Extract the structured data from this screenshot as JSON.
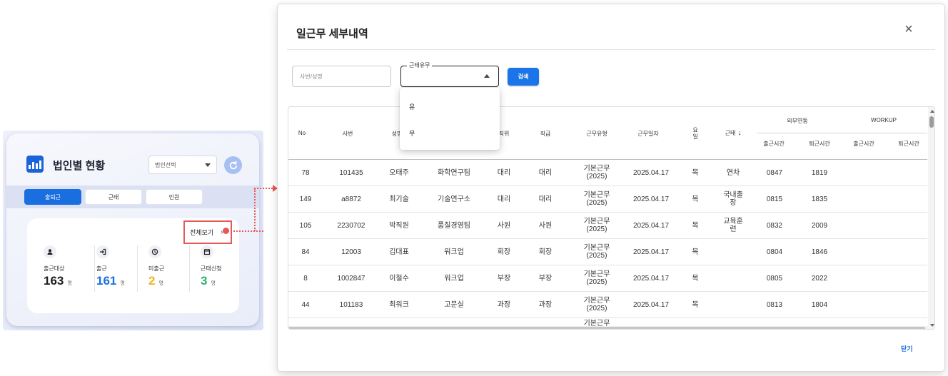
{
  "widget": {
    "title": "법인별 현황",
    "corp_select": "법인선택",
    "tabs": [
      {
        "label": "출퇴근",
        "active": true
      },
      {
        "label": "근태",
        "active": false
      },
      {
        "label": "인원",
        "active": false
      }
    ],
    "view_all": "전체보기",
    "unit": "명",
    "stats": [
      {
        "label": "출근대상",
        "value": "163",
        "color": "#1c1c1c",
        "icon": "person-icon"
      },
      {
        "label": "출근",
        "value": "161",
        "color": "#1a6fe0",
        "icon": "login-icon"
      },
      {
        "label": "미출근",
        "value": "2",
        "color": "#f2b51b",
        "icon": "clock-icon"
      },
      {
        "label": "근태신청",
        "value": "3",
        "color": "#2ab36a",
        "icon": "calendar-icon"
      }
    ]
  },
  "modal": {
    "title": "일근무 세부내역",
    "search_placeholder": "사번/성명",
    "attendance_label": "근태유무",
    "search_button": "검색",
    "dropdown_options": [
      "유",
      "무"
    ],
    "close_button": "닫기",
    "headers": {
      "no": "No",
      "emp_id": "사번",
      "name": "성명",
      "position": "직위",
      "rank": "직급",
      "work_type": "근무유형",
      "work_date": "근무일자",
      "weekday": "요일",
      "attendance": "근태",
      "external": "외부연동",
      "workup": "WORKUP",
      "clock_in": "출근시간",
      "clock_out": "퇴근시간"
    },
    "rows": [
      {
        "no": "78",
        "emp_id": "101435",
        "name": "오태주",
        "dept": "화학연구팀",
        "position": "대리",
        "rank": "대리",
        "work_type": "기본근무 (2025)",
        "work_date": "2025.04.17",
        "weekday": "목",
        "attendance": "연차",
        "ext_in": "0847",
        "ext_out": "1819"
      },
      {
        "no": "149",
        "emp_id": "a8872",
        "name": "최기술",
        "dept": "기술연구소",
        "position": "대리",
        "rank": "대리",
        "work_type": "기본근무 (2025)",
        "work_date": "2025.04.17",
        "weekday": "목",
        "attendance": "국내출장",
        "ext_in": "0815",
        "ext_out": "1835"
      },
      {
        "no": "105",
        "emp_id": "2230702",
        "name": "박직원",
        "dept": "품질경영팀",
        "position": "사원",
        "rank": "사원",
        "work_type": "기본근무 (2025)",
        "work_date": "2025.04.17",
        "weekday": "목",
        "attendance": "교육훈련",
        "ext_in": "0832",
        "ext_out": "2009"
      },
      {
        "no": "84",
        "emp_id": "12003",
        "name": "김대표",
        "dept": "워크업",
        "position": "회장",
        "rank": "회장",
        "work_type": "기본근무 (2025)",
        "work_date": "2025.04.17",
        "weekday": "목",
        "attendance": "",
        "ext_in": "0804",
        "ext_out": "1846"
      },
      {
        "no": "8",
        "emp_id": "1002847",
        "name": "이철수",
        "dept": "워크업",
        "position": "부장",
        "rank": "부장",
        "work_type": "기본근무 (2025)",
        "work_date": "2025.04.17",
        "weekday": "목",
        "attendance": "",
        "ext_in": "0805",
        "ext_out": "2022"
      },
      {
        "no": "44",
        "emp_id": "101183",
        "name": "최워크",
        "dept": "고문실",
        "position": "과장",
        "rank": "과장",
        "work_type": "기본근무 (2025)",
        "work_date": "2025.04.17",
        "weekday": "목",
        "attendance": "",
        "ext_in": "0813",
        "ext_out": "1804"
      }
    ],
    "partial_row_work_type": "기본근무"
  }
}
